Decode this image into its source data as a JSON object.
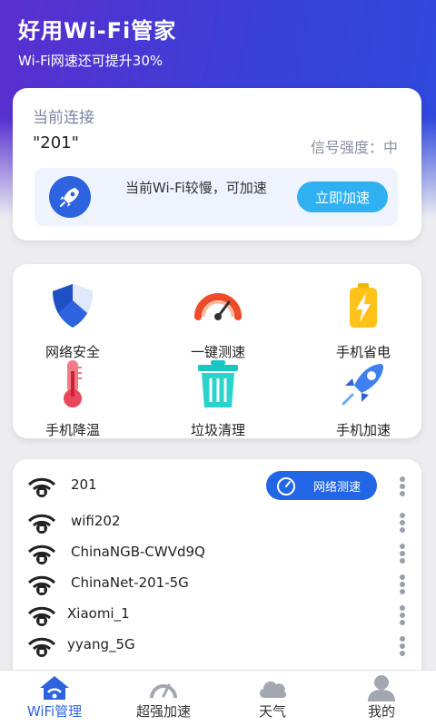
{
  "header": {
    "title": "好用Wi-Fi管家",
    "subtitle": "Wi-Fi网速还可提升30%"
  },
  "connection": {
    "label": "当前连接",
    "ssid": "\"201\"",
    "signal": "信号强度：中",
    "boost_text": "当前Wi-Fi较慢，可加速",
    "boost_button": "立即加速"
  },
  "tools": [
    {
      "label": "网络安全",
      "icon": "shield-icon"
    },
    {
      "label": "一键测速",
      "icon": "speedometer-icon"
    },
    {
      "label": "手机省电",
      "icon": "battery-icon"
    },
    {
      "label": "手机降温",
      "icon": "thermometer-icon"
    },
    {
      "label": "垃圾清理",
      "icon": "trash-icon"
    },
    {
      "label": "手机加速",
      "icon": "rocket-icon"
    }
  ],
  "wifi_list": {
    "speed_test_button": "网络测速",
    "networks": [
      {
        "name": "201",
        "locked": true
      },
      {
        "name": "wifi202",
        "locked": true
      },
      {
        "name": "ChinaNGB-CWVd9Q",
        "locked": true
      },
      {
        "name": "ChinaNet-201-5G",
        "locked": true
      },
      {
        "name": "Xiaomi_1",
        "locked": true
      },
      {
        "name": "yyang_5G",
        "locked": true
      }
    ]
  },
  "tabbar": {
    "items": [
      {
        "label": "WiFi管理",
        "icon": "home-wifi-icon",
        "active": true
      },
      {
        "label": "超强加速",
        "icon": "gauge-icon",
        "active": false
      },
      {
        "label": "天气",
        "icon": "cloud-icon",
        "active": false
      },
      {
        "label": "我的",
        "icon": "user-icon",
        "active": false
      }
    ]
  },
  "colors": {
    "header_gradient_start": "#5a2fd0",
    "header_gradient_end": "#2f49dc",
    "accent_blue": "#2e63e0",
    "boost_button": "#2fb1f1",
    "speed_test_button": "#2266e6"
  }
}
